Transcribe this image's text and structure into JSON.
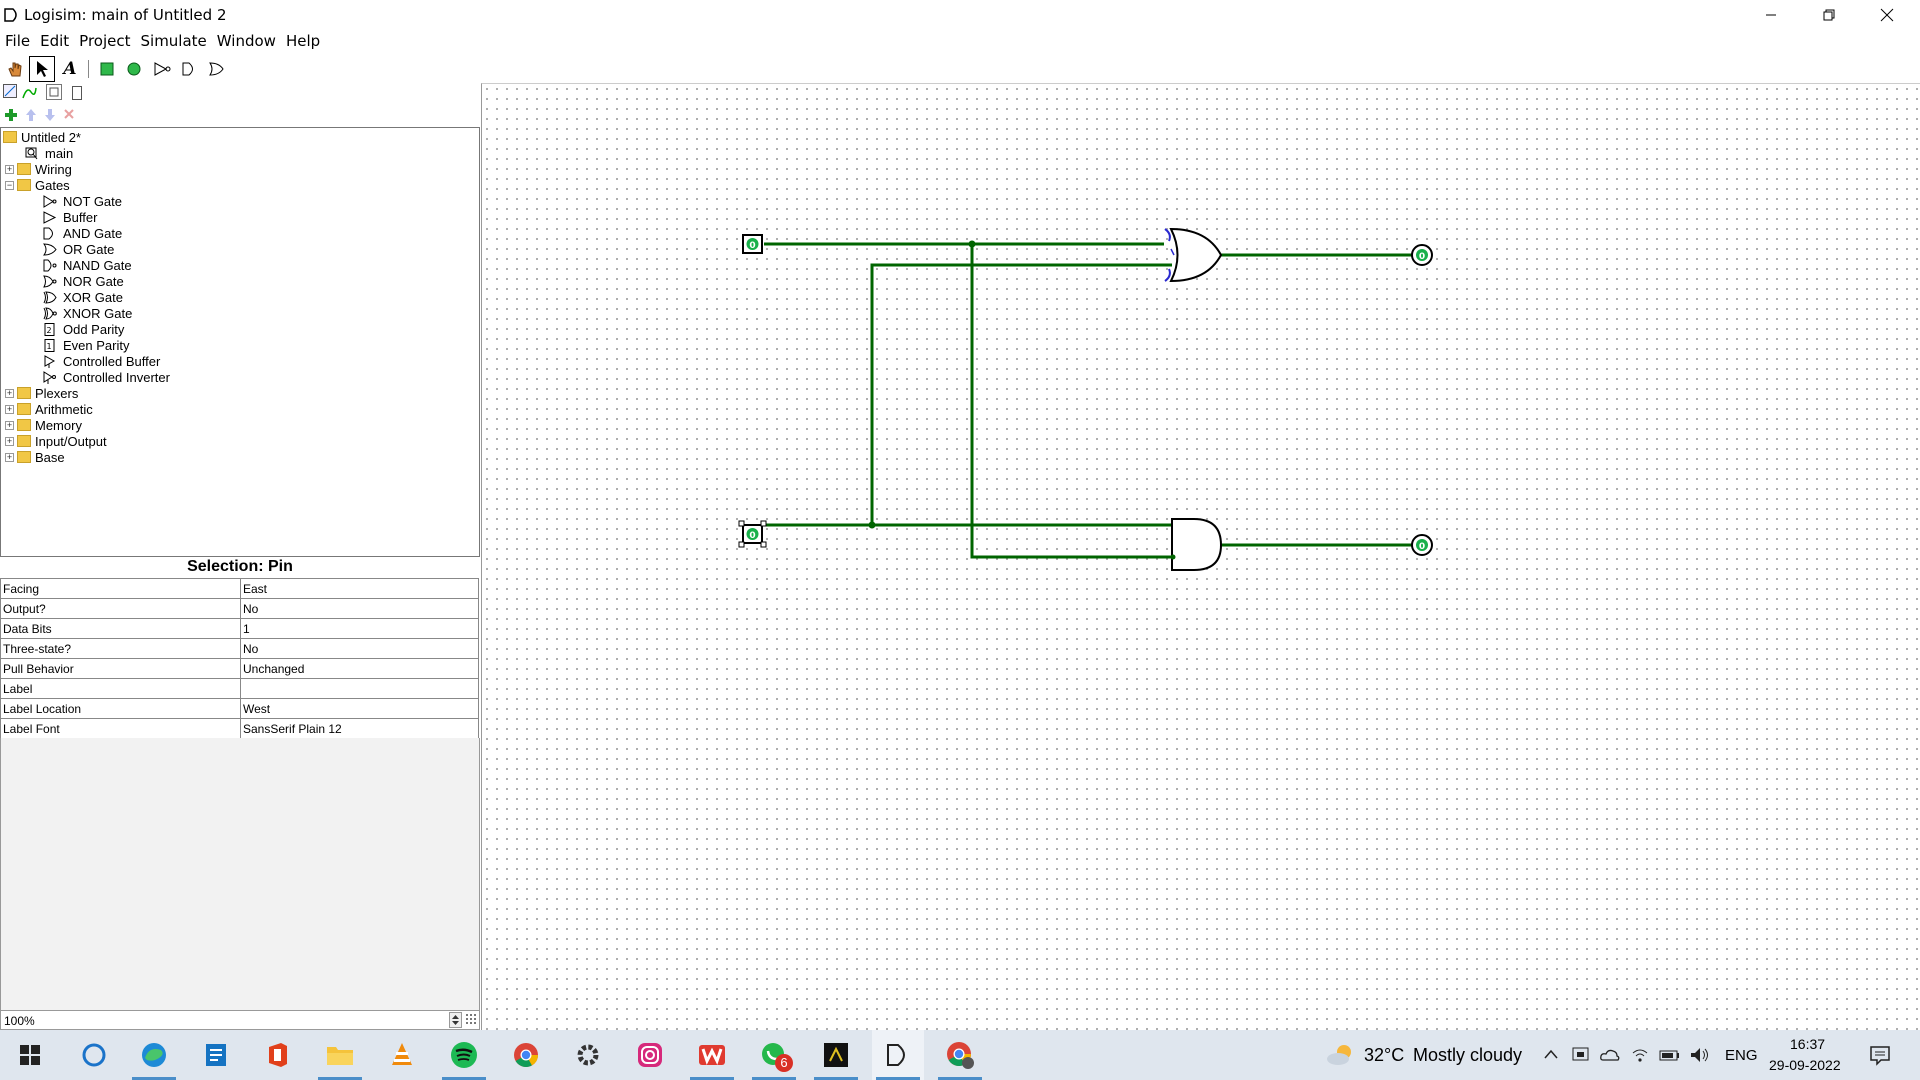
{
  "window": {
    "title": "Logisim: main of Untitled 2"
  },
  "menu": [
    "File",
    "Edit",
    "Project",
    "Simulate",
    "Window",
    "Help"
  ],
  "toolbar": {
    "tools": [
      "poke-tool",
      "select-tool",
      "text-tool",
      "input-pin",
      "output-pin",
      "not-gate",
      "and-gate",
      "or-gate"
    ],
    "text_tool_glyph": "A"
  },
  "tree": {
    "project": "Untitled 2*",
    "circuit": "main",
    "libraries": [
      {
        "name": "Wiring",
        "expanded": false
      },
      {
        "name": "Gates",
        "expanded": true,
        "items": [
          "NOT Gate",
          "Buffer",
          "AND Gate",
          "OR Gate",
          "NAND Gate",
          "NOR Gate",
          "XOR Gate",
          "XNOR Gate",
          "Odd Parity",
          "Even Parity",
          "Controlled Buffer",
          "Controlled Inverter"
        ]
      },
      {
        "name": "Plexers",
        "expanded": false
      },
      {
        "name": "Arithmetic",
        "expanded": false
      },
      {
        "name": "Memory",
        "expanded": false
      },
      {
        "name": "Input/Output",
        "expanded": false
      },
      {
        "name": "Base",
        "expanded": false
      }
    ]
  },
  "attributes": {
    "title": "Selection: Pin",
    "rows": [
      {
        "name": "Facing",
        "value": "East"
      },
      {
        "name": "Output?",
        "value": "No"
      },
      {
        "name": "Data Bits",
        "value": "1"
      },
      {
        "name": "Three-state?",
        "value": "No"
      },
      {
        "name": "Pull Behavior",
        "value": "Unchanged"
      },
      {
        "name": "Label",
        "value": ""
      },
      {
        "name": "Label Location",
        "value": "West"
      },
      {
        "name": "Label Font",
        "value": "SansSerif Plain 12"
      }
    ]
  },
  "zoom": "100%",
  "circuit": {
    "pin_value": "0",
    "wire_color": "#006400",
    "components": [
      "input-pin-a",
      "input-pin-b",
      "or-gate",
      "and-gate",
      "output-pin-sum",
      "output-pin-carry"
    ]
  },
  "taskbar": {
    "apps": [
      "windows-start",
      "cortana",
      "edge",
      "file-manager-app",
      "office",
      "file-explorer",
      "vlc",
      "spotify",
      "chrome",
      "settings",
      "instagram",
      "wps",
      "whatsapp",
      "app-dark",
      "logisim",
      "chrome-profile"
    ],
    "whatsapp_badge": "6",
    "weather_temp": "32°C",
    "weather_desc": "Mostly cloudy",
    "language": "ENG",
    "time": "16:37",
    "date": "29-09-2022"
  }
}
